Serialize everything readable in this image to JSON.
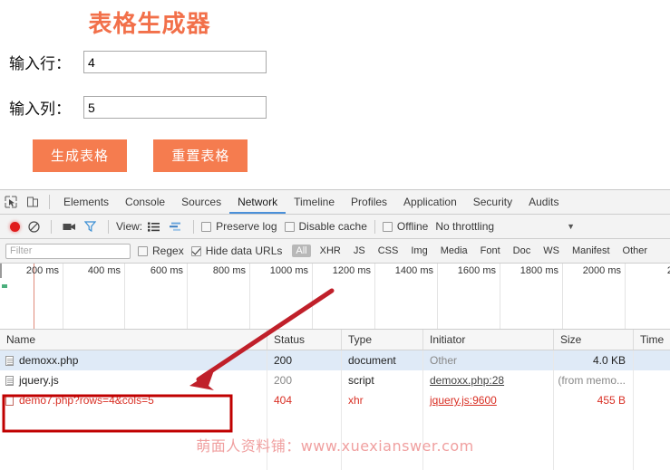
{
  "page": {
    "title": "表格生成器",
    "fields": [
      {
        "label": "输入行：",
        "value": "4",
        "placeholder": ""
      },
      {
        "label": "输入列：",
        "value": "5",
        "placeholder": ""
      }
    ],
    "buttons": {
      "generate": "生成表格",
      "reset": "重置表格"
    },
    "accent_color": "#f57c4f",
    "title_color": "#f2704a"
  },
  "devtools": {
    "tabs": [
      {
        "label": "Elements",
        "active": false
      },
      {
        "label": "Console",
        "active": false
      },
      {
        "label": "Sources",
        "active": false
      },
      {
        "label": "Network",
        "active": true
      },
      {
        "label": "Timeline",
        "active": false
      },
      {
        "label": "Profiles",
        "active": false
      },
      {
        "label": "Application",
        "active": false
      },
      {
        "label": "Security",
        "active": false
      },
      {
        "label": "Audits",
        "active": false
      }
    ],
    "tab_icons": {
      "inspect": "inspect-element-icon",
      "device": "toggle-device-toolbar-icon"
    },
    "controls": {
      "record": "record-icon",
      "clear": "clear-icon",
      "capture_screenshots": "camera-icon",
      "filter": "funnel-icon",
      "view_label": "View:",
      "view_list": "list-view-icon",
      "view_waterfall": "waterfall-view-icon",
      "preserve_log": {
        "label": "Preserve log",
        "checked": false
      },
      "disable_cache": {
        "label": "Disable cache",
        "checked": false
      },
      "offline": {
        "label": "Offline",
        "checked": false
      },
      "throttling": "No throttling",
      "throttling_caret": "▼"
    },
    "filter_bar": {
      "filter_placeholder": "Filter",
      "filter_value": "",
      "regex": {
        "label": "Regex",
        "checked": false
      },
      "hide_data_urls": {
        "label": "Hide data URLs",
        "checked": true
      },
      "types": [
        {
          "label": "All",
          "selected": true
        },
        {
          "label": "XHR",
          "selected": false
        },
        {
          "label": "JS",
          "selected": false
        },
        {
          "label": "CSS",
          "selected": false
        },
        {
          "label": "Img",
          "selected": false
        },
        {
          "label": "Media",
          "selected": false
        },
        {
          "label": "Font",
          "selected": false
        },
        {
          "label": "Doc",
          "selected": false
        },
        {
          "label": "WS",
          "selected": false
        },
        {
          "label": "Manifest",
          "selected": false
        },
        {
          "label": "Other",
          "selected": false
        }
      ]
    },
    "timeline": {
      "ticks": [
        "200 ms",
        "400 ms",
        "600 ms",
        "800 ms",
        "1000 ms",
        "1200 ms",
        "1400 ms",
        "1600 ms",
        "1800 ms",
        "2000 ms",
        "2"
      ]
    },
    "table": {
      "columns": [
        "Name",
        "Status",
        "Type",
        "Initiator",
        "Size",
        "Time"
      ],
      "rows": [
        {
          "name": "demoxx.php",
          "status": "200",
          "type": "document",
          "initiator": "Other",
          "initiator_link": false,
          "size": "4.0 KB",
          "time": "",
          "selected": true,
          "error": false
        },
        {
          "name": "jquery.js",
          "status": "200",
          "type": "script",
          "initiator": "demoxx.php:28",
          "initiator_link": true,
          "size": "(from memo...",
          "time": "",
          "selected": false,
          "error": false
        },
        {
          "name": "demo7.php?rows=4&cols=5",
          "status": "404",
          "type": "xhr",
          "initiator": "jquery.js:9600",
          "initiator_link": true,
          "size": "455 B",
          "time": "",
          "selected": false,
          "error": true
        }
      ]
    }
  },
  "annotations": {
    "highlight_color": "#c00000",
    "arrow_color": "#c0202a",
    "highlight_target": "demo7.php?rows=4&cols=5"
  },
  "watermark": {
    "text": "萌面人资料铺：www.xuexianswer.com",
    "color": "#f0a0a0"
  }
}
